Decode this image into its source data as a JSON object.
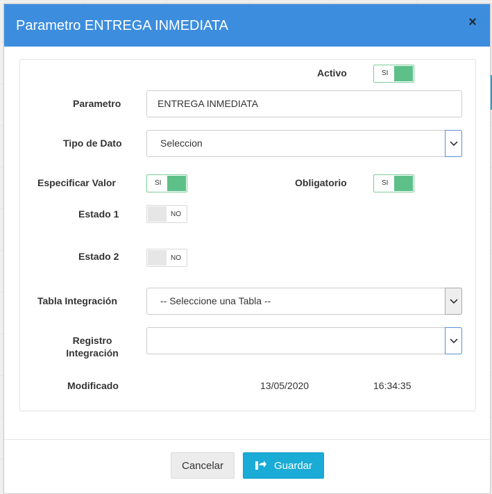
{
  "modal": {
    "title": "Parametro ENTREGA INMEDIATA",
    "close_icon": "close-icon"
  },
  "form": {
    "activo": {
      "label": "Activo",
      "toggle_text": "SI",
      "state": "on"
    },
    "parametro": {
      "label": "Parametro",
      "value": "ENTREGA INMEDIATA"
    },
    "tipo_dato": {
      "label": "Tipo de Dato",
      "value": "Seleccion"
    },
    "especificar_valor": {
      "label": "Especificar Valor",
      "toggle_text": "SI",
      "state": "on"
    },
    "obligatorio": {
      "label": "Obligatorio",
      "toggle_text": "SI",
      "state": "on"
    },
    "estado1": {
      "label": "Estado 1",
      "toggle_text": "NO",
      "state": "off"
    },
    "estado2": {
      "label": "Estado 2",
      "toggle_text": "NO",
      "state": "off"
    },
    "tabla_integracion": {
      "label": "Tabla Integración",
      "value": "-- Seleccione una Tabla --"
    },
    "registro_integracion": {
      "label_line1": "Registro",
      "label_line2": "Integración",
      "value": ""
    },
    "modificado": {
      "label": "Modificado",
      "date": "13/05/2020",
      "time": "16:34:35"
    }
  },
  "footer": {
    "cancel_label": "Cancelar",
    "save_label": "Guardar",
    "save_icon": "save-share-icon"
  },
  "colors": {
    "header": "#3c8dde",
    "toggle_on": "#5cc088",
    "save_button": "#1aabd6"
  }
}
